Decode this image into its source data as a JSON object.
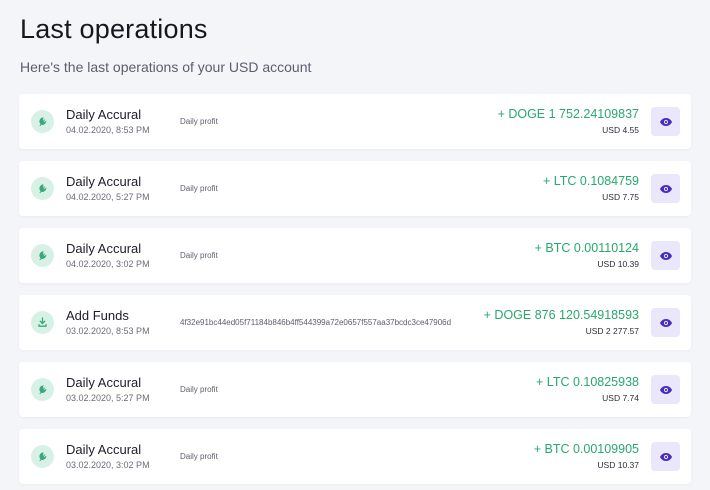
{
  "header": {
    "title": "Last operations",
    "subtitle": "Here's the last operations of your USD account"
  },
  "colors": {
    "amount_positive": "#27a86f",
    "icon_bg": "#d8f1e6",
    "icon_fg": "#3aa87a",
    "view_bg": "#ebe7fb",
    "view_fg": "#4a2bc2"
  },
  "operations": [
    {
      "icon": "sprout-icon",
      "name": "Daily Accural",
      "date": "04.02.2020, 8:53 PM",
      "description": "Daily profit",
      "amount": "+ DOGE 1 752.24109837",
      "usd": "USD 4.55"
    },
    {
      "icon": "sprout-icon",
      "name": "Daily Accural",
      "date": "04.02.2020, 5:27 PM",
      "description": "Daily profit",
      "amount": "+ LTC 0.1084759",
      "usd": "USD 7.75"
    },
    {
      "icon": "sprout-icon",
      "name": "Daily Accural",
      "date": "04.02.2020, 3:02 PM",
      "description": "Daily profit",
      "amount": "+ BTC 0.00110124",
      "usd": "USD 10.39"
    },
    {
      "icon": "download-icon",
      "name": "Add Funds",
      "date": "03.02.2020, 8:53 PM",
      "description": "4f32e91bc44ed05f71184b846b4ff544399a72e0657f557aa37bcdc3ce47906d",
      "amount": "+ DOGE 876 120.54918593",
      "usd": "USD 2 277.57"
    },
    {
      "icon": "sprout-icon",
      "name": "Daily Accural",
      "date": "03.02.2020, 5:27 PM",
      "description": "Daily profit",
      "amount": "+ LTC 0.10825938",
      "usd": "USD 7.74"
    },
    {
      "icon": "sprout-icon",
      "name": "Daily Accural",
      "date": "03.02.2020, 3:02 PM",
      "description": "Daily profit",
      "amount": "+ BTC 0.00109905",
      "usd": "USD 10.37"
    }
  ]
}
